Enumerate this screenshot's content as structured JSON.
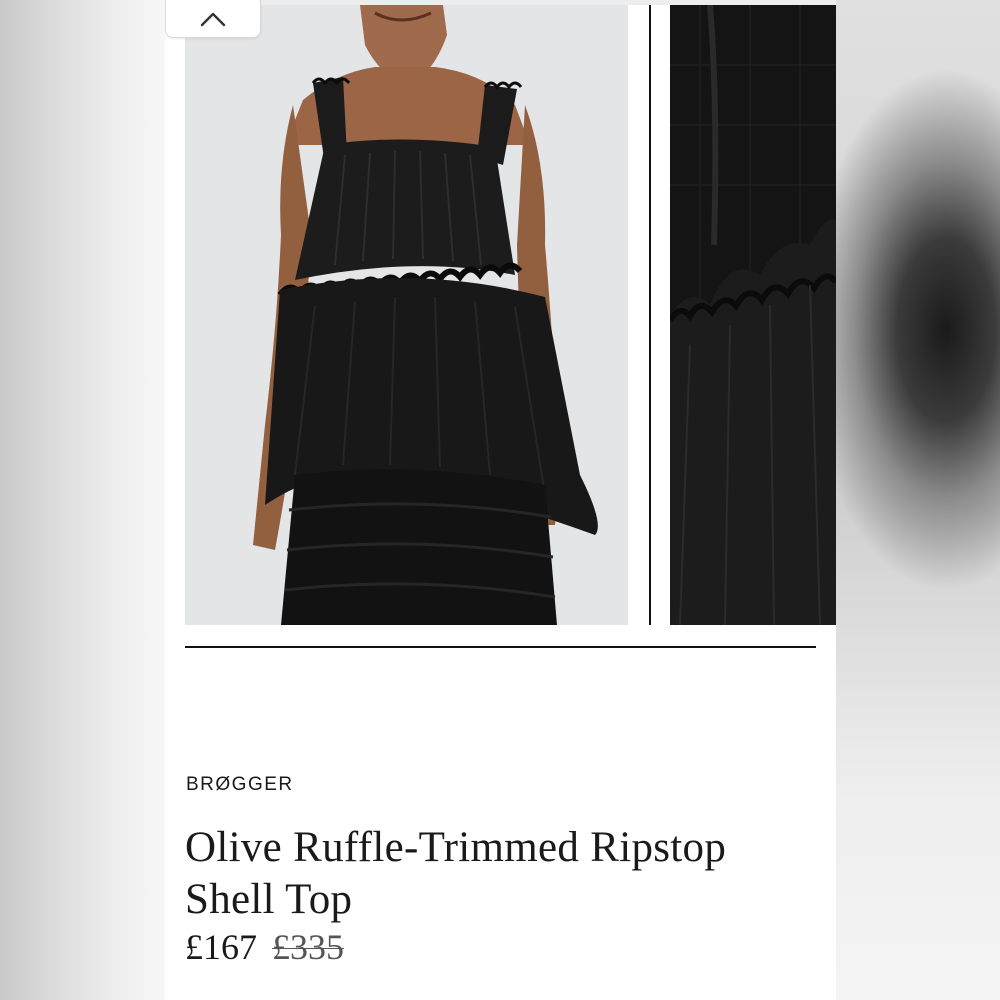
{
  "product": {
    "brand": "BRØGGER",
    "title": "Olive Ruffle-Trimmed Ripstop Shell Top",
    "price_current": "£167",
    "price_original": "£335"
  },
  "gallery": {
    "images": [
      {
        "alt": "model wearing black tiered ruffle top"
      },
      {
        "alt": "close-up of ruffle fabric detail"
      }
    ],
    "collapse_icon": "chevron-up-icon"
  },
  "colors": {
    "garment": "#151515",
    "background_photo": "#e4e5e6",
    "text": "#1a1a1a"
  }
}
